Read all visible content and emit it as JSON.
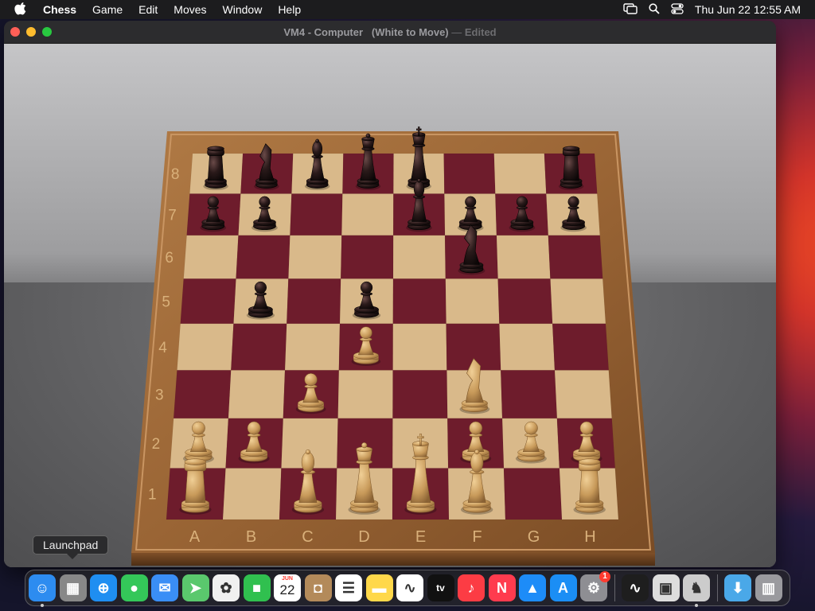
{
  "menubar": {
    "app_name": "Chess",
    "items": [
      "Game",
      "Edit",
      "Moves",
      "Window",
      "Help"
    ],
    "clock": "Thu Jun 22  12:55 AM"
  },
  "window": {
    "title_main": "VM4 - Computer   (White to Move)",
    "title_sep": "—",
    "title_edited": "Edited"
  },
  "board": {
    "files": [
      "A",
      "B",
      "C",
      "D",
      "E",
      "F",
      "G",
      "H"
    ],
    "ranks": [
      "8",
      "7",
      "6",
      "5",
      "4",
      "3",
      "2",
      "1"
    ],
    "light_square_color": "#d9b98a",
    "dark_square_color": "#6e1c2c",
    "white_piece_color": "#c89a5a",
    "black_piece_color": "#2a1a1a",
    "pieces": [
      {
        "square": "a8",
        "color": "black",
        "type": "rook"
      },
      {
        "square": "b8",
        "color": "black",
        "type": "knight"
      },
      {
        "square": "c8",
        "color": "black",
        "type": "bishop"
      },
      {
        "square": "d8",
        "color": "black",
        "type": "queen"
      },
      {
        "square": "e8",
        "color": "black",
        "type": "king"
      },
      {
        "square": "h8",
        "color": "black",
        "type": "rook"
      },
      {
        "square": "a7",
        "color": "black",
        "type": "pawn"
      },
      {
        "square": "b7",
        "color": "black",
        "type": "pawn"
      },
      {
        "square": "e7",
        "color": "black",
        "type": "bishop"
      },
      {
        "square": "f7",
        "color": "black",
        "type": "pawn"
      },
      {
        "square": "g7",
        "color": "black",
        "type": "pawn"
      },
      {
        "square": "h7",
        "color": "black",
        "type": "pawn"
      },
      {
        "square": "f6",
        "color": "black",
        "type": "knight"
      },
      {
        "square": "b5",
        "color": "black",
        "type": "pawn"
      },
      {
        "square": "d5",
        "color": "black",
        "type": "pawn"
      },
      {
        "square": "d4",
        "color": "white",
        "type": "pawn"
      },
      {
        "square": "c3",
        "color": "white",
        "type": "pawn"
      },
      {
        "square": "f3",
        "color": "white",
        "type": "knight"
      },
      {
        "square": "a2",
        "color": "white",
        "type": "pawn"
      },
      {
        "square": "b2",
        "color": "white",
        "type": "pawn"
      },
      {
        "square": "f2",
        "color": "white",
        "type": "pawn"
      },
      {
        "square": "g2",
        "color": "white",
        "type": "pawn"
      },
      {
        "square": "h2",
        "color": "white",
        "type": "pawn"
      },
      {
        "square": "a1",
        "color": "white",
        "type": "rook"
      },
      {
        "square": "c1",
        "color": "white",
        "type": "bishop"
      },
      {
        "square": "d1",
        "color": "white",
        "type": "queen"
      },
      {
        "square": "e1",
        "color": "white",
        "type": "king"
      },
      {
        "square": "f1",
        "color": "white",
        "type": "bishop"
      },
      {
        "square": "h1",
        "color": "white",
        "type": "rook"
      }
    ]
  },
  "tooltip": {
    "text": "Launchpad"
  },
  "dock": {
    "items": [
      {
        "name": "finder",
        "icon": "finder-icon",
        "color": "#2d8cf0",
        "running": true
      },
      {
        "name": "launchpad",
        "icon": "launchpad-icon",
        "color": "#888888"
      },
      {
        "name": "safari",
        "icon": "safari-icon",
        "color": "#1f8ef1"
      },
      {
        "name": "messages",
        "icon": "messages-icon",
        "color": "#34c759"
      },
      {
        "name": "mail",
        "icon": "mail-icon",
        "color": "#3a8ef6"
      },
      {
        "name": "maps",
        "icon": "maps-icon",
        "color": "#5ac86d"
      },
      {
        "name": "photos",
        "icon": "photos-icon",
        "color": "#f0f0f0"
      },
      {
        "name": "facetime",
        "icon": "facetime-icon",
        "color": "#30c04f"
      },
      {
        "name": "calendar",
        "icon": "calendar-icon",
        "color": "#ffffff",
        "month": "JUN",
        "day": "22"
      },
      {
        "name": "contacts",
        "icon": "contacts-icon",
        "color": "#b38a5a"
      },
      {
        "name": "reminders",
        "icon": "reminders-icon",
        "color": "#ffffff"
      },
      {
        "name": "notes",
        "icon": "notes-icon",
        "color": "#ffd84a"
      },
      {
        "name": "freeform",
        "icon": "freeform-icon",
        "color": "#ffffff"
      },
      {
        "name": "tv",
        "icon": "tv-icon",
        "color": "#111111",
        "label": "tv"
      },
      {
        "name": "music",
        "icon": "music-icon",
        "color": "#fc3c44"
      },
      {
        "name": "news",
        "icon": "news-icon",
        "color": "#ff3b4e"
      },
      {
        "name": "keynote",
        "icon": "keynote-icon",
        "color": "#1d8cf8"
      },
      {
        "name": "app-store",
        "icon": "app-store-icon",
        "color": "#1b8ef5"
      },
      {
        "name": "system-settings",
        "icon": "gear-icon",
        "color": "#8e8e93",
        "badge": "1"
      },
      {
        "name": "activity-monitor",
        "icon": "activity-monitor-icon",
        "color": "#1e1e1e"
      },
      {
        "name": "preview",
        "icon": "preview-icon",
        "color": "#dddddd"
      },
      {
        "name": "chess",
        "icon": "chess-icon",
        "color": "#cccccc",
        "running": true
      },
      {
        "name": "downloads",
        "icon": "downloads-folder-icon",
        "color": "#4aa8e8"
      },
      {
        "name": "trash",
        "icon": "trash-icon",
        "color": "#9a9a9e"
      }
    ]
  }
}
